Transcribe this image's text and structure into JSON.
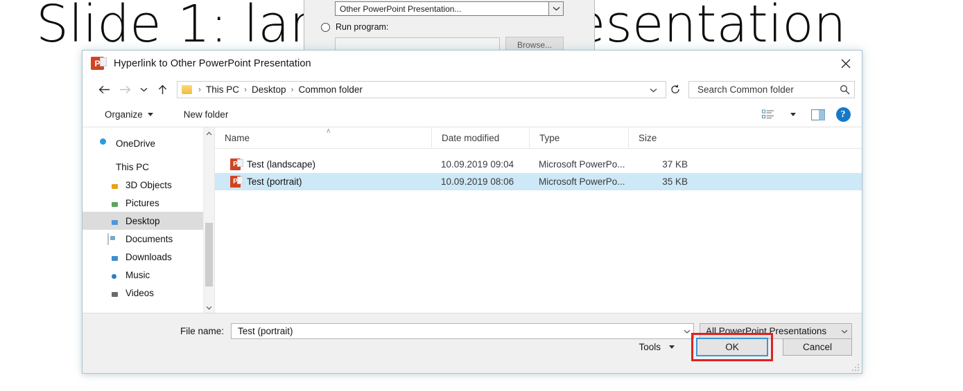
{
  "background": {
    "slide_title": "Slide 1: landscape presentation",
    "action_settings": {
      "hyperlink_combo_value": "Other PowerPoint Presentation...",
      "run_program_label": "Run program:",
      "run_program_value": "",
      "browse_label": "Browse..."
    }
  },
  "dialog": {
    "title": "Hyperlink to Other PowerPoint Presentation",
    "app_icon": "powerpoint-icon",
    "close_label": "✕",
    "nav": {
      "back": "←",
      "forward": "→",
      "recent": "∨",
      "up": "↑",
      "refresh": "↻",
      "breadcrumb": [
        "This PC",
        "Desktop",
        "Common folder"
      ],
      "breadcrumb_separator": "›",
      "dropdown_chevron": "∨"
    },
    "search": {
      "placeholder": "Search Common folder",
      "value": "",
      "icon": "search-icon"
    },
    "commandbar": {
      "organize": "Organize",
      "new_folder": "New folder",
      "view_icon": "list-view-icon",
      "view_dropdown": "▾",
      "preview_pane_icon": "preview-pane-icon",
      "help_label": "?"
    },
    "navpane": {
      "items": [
        {
          "label": "OneDrive",
          "icon": "cloud-icon",
          "level": 0,
          "selected": false
        },
        {
          "label": "This PC",
          "icon": "computer-icon",
          "level": 0,
          "selected": false
        },
        {
          "label": "3D Objects",
          "icon": "folder-icon",
          "level": 1,
          "selected": false
        },
        {
          "label": "Pictures",
          "icon": "folder-icon",
          "level": 1,
          "selected": false
        },
        {
          "label": "Desktop",
          "icon": "folder-icon",
          "level": 1,
          "selected": true
        },
        {
          "label": "Documents",
          "icon": "folder-icon",
          "level": 1,
          "selected": false
        },
        {
          "label": "Downloads",
          "icon": "folder-icon",
          "level": 1,
          "selected": false
        },
        {
          "label": "Music",
          "icon": "folder-icon",
          "level": 1,
          "selected": false
        },
        {
          "label": "Videos",
          "icon": "folder-icon",
          "level": 1,
          "selected": false
        }
      ],
      "scroll_up": "∧",
      "scroll_down": "∨"
    },
    "filelist": {
      "columns": [
        "Name",
        "Date modified",
        "Type",
        "Size"
      ],
      "sort_indicator": "∧",
      "rows": [
        {
          "name": "Test (landscape)",
          "date_modified": "10.09.2019 09:04",
          "type": "Microsoft PowerPo...",
          "size": "37 KB",
          "icon": "powerpoint-file-icon",
          "selected": false
        },
        {
          "name": "Test (portrait)",
          "date_modified": "10.09.2019 08:06",
          "type": "Microsoft PowerPo...",
          "size": "35 KB",
          "icon": "powerpoint-file-icon",
          "selected": true
        }
      ]
    },
    "footer": {
      "filename_label": "File name:",
      "filename_value": "Test (portrait)",
      "filename_placeholder": "",
      "filetype_value": "All PowerPoint Presentations",
      "tools_label": "Tools",
      "tools_caret": "▾",
      "ok_label": "OK",
      "cancel_label": "Cancel"
    }
  },
  "colors": {
    "accent_blue": "#1878c8",
    "selection_blue": "#cde8f7",
    "highlight_red": "#e02020",
    "focus_ring": "#3f93d4",
    "ppt_orange": "#d04423"
  }
}
